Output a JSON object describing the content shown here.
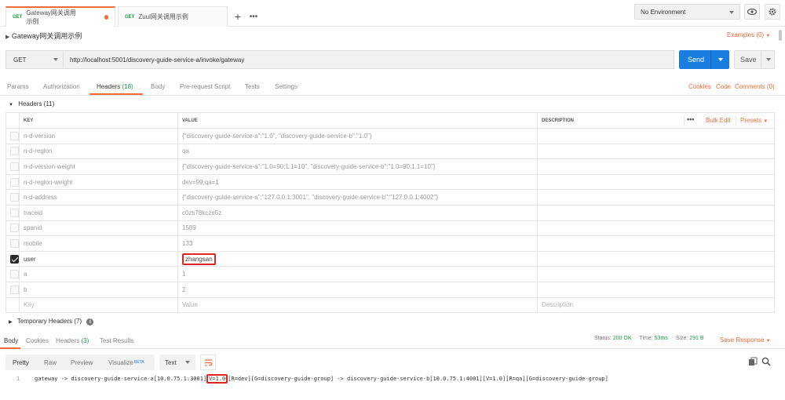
{
  "tabs": [
    {
      "method": "GET",
      "title": "Gateway网关调用示例",
      "active": true
    },
    {
      "method": "GET",
      "title": "Zuul网关调用示例",
      "active": false
    }
  ],
  "tabbar": {
    "add_icon": "plus",
    "more_icon": "ellipsis"
  },
  "environment": {
    "selected": "No Environment",
    "eye_icon": "eye",
    "settings_icon": "gear"
  },
  "request": {
    "name": "Gateway网关调用示例",
    "examples_label": "Examples (0)",
    "method": "GET",
    "url": "http://localhost:5001/discovery-guide-service-a/invoke/gateway",
    "send_label": "Send",
    "save_label": "Save"
  },
  "request_tabs": {
    "params": "Params",
    "authorization": "Authorization",
    "headers": "Headers",
    "headers_count": "(18)",
    "body": "Body",
    "prerequest": "Pre-request Script",
    "tests": "Tests",
    "settings": "Settings",
    "cookies": "Cookies",
    "code": "Code",
    "comments": "Comments (0)"
  },
  "headers_section": {
    "title": "Headers (11)",
    "columns": {
      "key": "KEY",
      "value": "VALUE",
      "description": "DESCRIPTION"
    },
    "more_icon": "ellipsis",
    "bulk_edit": "Bulk Edit",
    "presets": "Presets",
    "rows": [
      {
        "checked": false,
        "key": "n-d-version",
        "value": "{\"discovery-guide-service-a\":\"1.0\", \"discovery-guide-service-b\":\"1.0\"}"
      },
      {
        "checked": false,
        "key": "n-d-region",
        "value": "qa"
      },
      {
        "checked": false,
        "key": "n-d-version-weight",
        "value": "{\"discovery-guide-service-a\":\"1.0=90;1.1=10\", \"discovery-guide-service-b\":\"1.0=90;1.1=10\"}"
      },
      {
        "checked": false,
        "key": "n-d-region-weight",
        "value": "dev=99;qa=1"
      },
      {
        "checked": false,
        "key": "n-d-address",
        "value": "{\"discovery-guide-service-a\":\"127.0.0.1:3001\", \"discovery-guide-service-b\":\"127.0.0.1:4002\"}"
      },
      {
        "checked": false,
        "key": "traceid",
        "value": "c0zs78kcze5z"
      },
      {
        "checked": false,
        "key": "spanid",
        "value": "1589"
      },
      {
        "checked": false,
        "key": "mobile",
        "value": "133"
      },
      {
        "checked": true,
        "key": "user",
        "value": "zhangsan"
      },
      {
        "checked": false,
        "key": "a",
        "value": "1"
      },
      {
        "checked": false,
        "key": "b",
        "value": "2"
      }
    ],
    "placeholder_row": {
      "key": "Key",
      "value": "Value",
      "description": "Description"
    }
  },
  "temporary_headers": {
    "title": "Temporary Headers (7)",
    "info_icon": "info"
  },
  "response": {
    "tabs": {
      "body": "Body",
      "cookies": "Cookies",
      "headers": "Headers",
      "headers_count": "(3)",
      "test_results": "Test Results"
    },
    "status_label": "Status:",
    "status_value": "200 OK",
    "time_label": "Time:",
    "time_value": "53ms",
    "size_label": "Size:",
    "size_value": "291 B",
    "save_response": "Save Response",
    "view_modes": [
      "Pretty",
      "Raw",
      "Preview",
      "Visualize"
    ],
    "beta_badge": "BETA",
    "format": "Text",
    "line_number": "1",
    "body_before": "gateway -> discovery-guide-service-a[10.0.75.1:3001]",
    "body_highlight": "V=1.0",
    "body_after": "[R=dev][G=discovery-guide-group] -> discovery-guide-service-b[10.0.75.1:4001][V=1.0][R=qa][G=discovery-guide-group]"
  },
  "colors": {
    "accent": "#f26b3a",
    "send": "#1a7de0",
    "status_ok": "#1c9a44",
    "highlight": "#e02424"
  }
}
